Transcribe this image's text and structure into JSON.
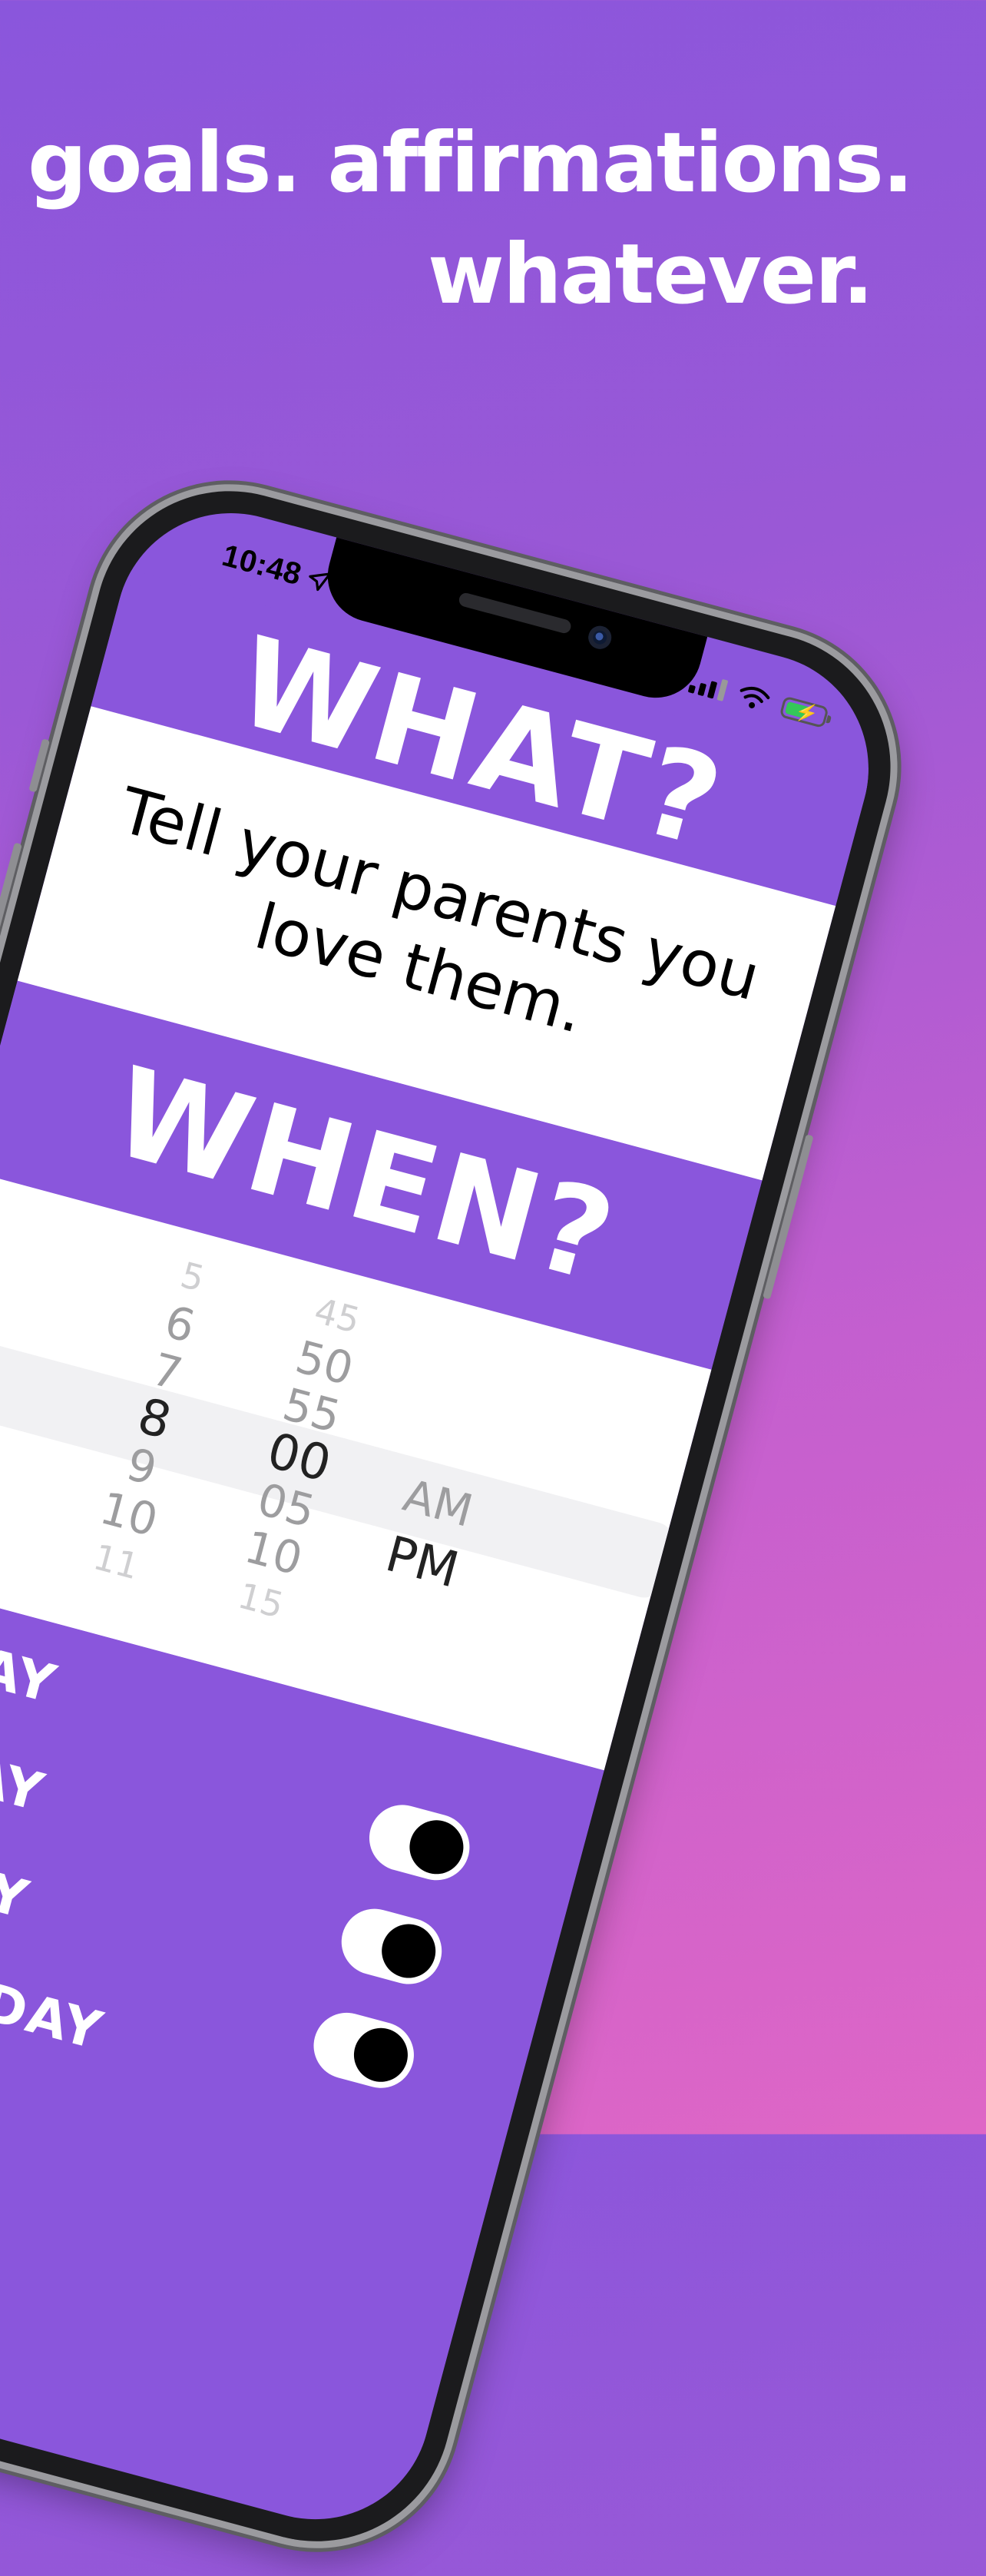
{
  "headline": {
    "line1": "goals. affirmations.",
    "line2": "whatever."
  },
  "status_bar": {
    "time": "10:48",
    "location_icon": "location-arrow-icon",
    "signal_icon": "cellular-signal-icon",
    "wifi_icon": "wifi-icon",
    "battery_icon": "battery-charging-icon",
    "battery_color": "#34c759"
  },
  "what": {
    "title": "WHAT?",
    "text": "Tell your parents you love them."
  },
  "when": {
    "title": "WHEN?",
    "picker": {
      "hours": [
        "5",
        "6",
        "7",
        "8",
        "9",
        "10",
        "11"
      ],
      "minutes": [
        "45",
        "50",
        "55",
        "00",
        "05",
        "10",
        "15"
      ],
      "ampm": [
        "AM",
        "PM"
      ],
      "selected_hour": "8",
      "selected_minute": "00",
      "selected_period": "PM"
    }
  },
  "days": [
    {
      "label": "SUNDAY",
      "on": null
    },
    {
      "label": "MONDAY",
      "on": true
    },
    {
      "label": "TUESDAY",
      "on": true
    },
    {
      "label": "WEDNESDAY",
      "on": true
    }
  ],
  "colors": {
    "accent_purple": "#8a56dc",
    "gradient_bottom": "#de66c6",
    "toggle_on_track": "#ffffff",
    "toggle_knob": "#000000"
  }
}
